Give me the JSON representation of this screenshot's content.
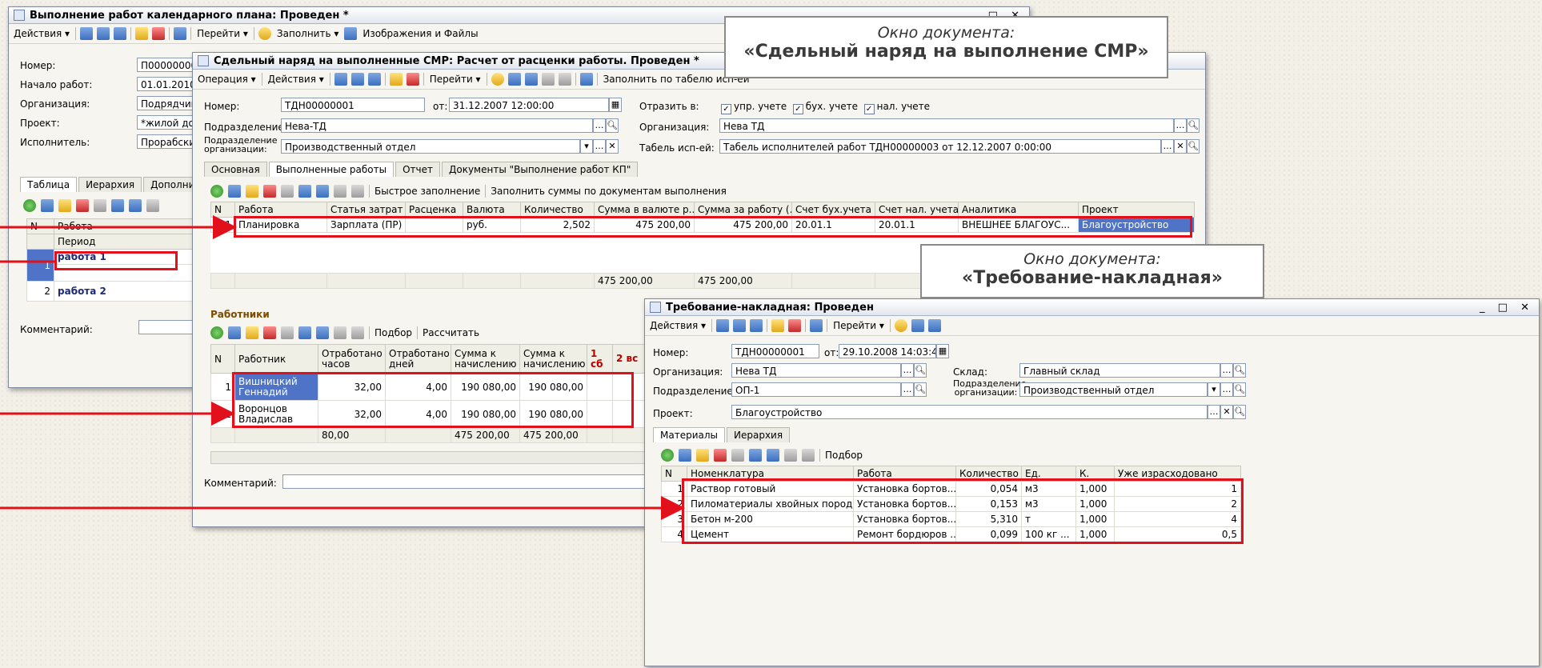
{
  "win1": {
    "title": "Выполнение работ календарного плана: Проведен *",
    "toolbar": [
      "Действия ▾",
      "Перейти ▾",
      "Заполнить ▾",
      "Изображения и Файлы"
    ],
    "fields": {
      "number_label": "Номер:",
      "number": "П00000000",
      "start_label": "Начало работ:",
      "start": "01.01.2010",
      "org_label": "Организация:",
      "org": "Подрядчик",
      "project_label": "Проект:",
      "project": "*жилой дом",
      "executor_label": "Исполнитель:",
      "executor": "Прорабски"
    },
    "tabs": [
      "Таблица",
      "Иерархия",
      "Дополнит"
    ],
    "table": {
      "headers": [
        "N",
        "Работа"
      ],
      "subheader": "Период",
      "rows": [
        {
          "n": "1",
          "work": "работа 1"
        },
        {
          "n": "2",
          "work": "работа 2"
        }
      ]
    },
    "comment_label": "Комментарий:"
  },
  "win2": {
    "title": "Сдельный наряд на выполненные СМР: Расчет от расценки работы. Проведен *",
    "toolbar": [
      "Операция ▾",
      "Действия ▾",
      "Перейти ▾",
      "Заполнить по табелю исп-ей"
    ],
    "fields": {
      "number_label": "Номер:",
      "number": "ТДН00000001",
      "from_label": "от:",
      "from": "31.12.2007 12:00:00",
      "reflect_label": "Отразить в:",
      "reflect": [
        "упр. учете",
        "бух. учете",
        "нал. учете"
      ],
      "dept_label": "Подразделение:",
      "dept": "Нева-ТД",
      "org_label": "Организация:",
      "org": "Нева ТД",
      "orgdept_label": "Подразделение организации:",
      "orgdept": "Производственный отдел",
      "timesheet_label": "Табель исп-ей:",
      "timesheet": "Табель исполнителей работ ТДН00000003 от 12.12.2007 0:00:00"
    },
    "tabs": [
      "Основная",
      "Выполненные работы",
      "Отчет",
      "Документы \"Выполнение работ КП\""
    ],
    "works_toolbar": [
      "Быстрое заполнение",
      "Заполнить суммы по документам выполнения"
    ],
    "works": {
      "headers": [
        "N",
        "Работа",
        "Статья затрат",
        "Расценка",
        "Валюта",
        "Количество",
        "Сумма в валюте р...",
        "Сумма за работу (...",
        "Счет бух.учета",
        "Счет нал. учета",
        "Аналитика",
        "Проект"
      ],
      "rows": [
        [
          "1",
          "Планировка",
          "Зарплата (ПР)",
          "",
          "руб.",
          "2,502",
          "475 200,00",
          "475 200,00",
          "20.01.1",
          "20.01.1",
          "ВНЕШНЕЕ БЛАГОУС...",
          "Благоустройство"
        ]
      ],
      "totals": [
        "475 200,00",
        "475 200,00"
      ]
    },
    "workers_title": "Работники",
    "workers_toolbar": [
      "Подбор",
      "Рассчитать"
    ],
    "workers": {
      "headers": [
        "N",
        "Работник",
        "Отработано часов",
        "Отработано дней",
        "Сумма к начислению",
        "Сумма к начислению",
        "1 сб",
        "2 вс"
      ],
      "rows": [
        [
          "1",
          "Вишницкий Геннадий",
          "32,00",
          "4,00",
          "190 080,00",
          "190 080,00"
        ],
        [
          "2",
          "Воронцов Владислав",
          "32,00",
          "4,00",
          "190 080,00",
          "190 080,00"
        ]
      ],
      "totals": [
        "80,00",
        "475 200,00",
        "475 200,00"
      ]
    },
    "comment_label": "Комментарий:"
  },
  "win3": {
    "title": "Требование-накладная: Проведен",
    "toolbar": [
      "Действия ▾",
      "Перейти ▾"
    ],
    "fields": {
      "number_label": "Номер:",
      "number": "ТДН00000001",
      "from_label": "от:",
      "from": "29.10.2008 14:03:45",
      "org_label": "Организация:",
      "org": "Нева ТД",
      "stock_label": "Склад:",
      "stock": "Главный склад",
      "dept_label": "Подразделение:",
      "dept": "ОП-1",
      "orgdept_label": "Подразделение организации:",
      "orgdept": "Производственный отдел",
      "project_label": "Проект:",
      "project": "Благоустройство"
    },
    "tabs": [
      "Материалы",
      "Иерархия"
    ],
    "sub_toolbar": "Подбор",
    "materials": {
      "headers": [
        "N",
        "Номенклатура",
        "Работа",
        "Количество",
        "Ед.",
        "К.",
        "Уже израсходовано"
      ],
      "rows": [
        [
          "1",
          "Раствор готовый",
          "Установка бортов...",
          "0,054",
          "м3",
          "1,000",
          "1"
        ],
        [
          "2",
          "Пиломатериалы хвойных пород",
          "Установка бортов...",
          "0,153",
          "м3",
          "1,000",
          "2"
        ],
        [
          "3",
          "Бетон м-200",
          "Установка бортов...",
          "5,310",
          "т",
          "1,000",
          "4"
        ],
        [
          "4",
          "Цемент",
          "Ремонт бордюров ...",
          "0,099",
          "100 кг ...",
          "1,000",
          "0,5"
        ]
      ]
    }
  },
  "callout1": {
    "line1": "Окно документа:",
    "line2": "«Сдельный наряд на выполнение СМР»"
  },
  "callout2": {
    "line1": "Окно документа:",
    "line2": "«Требование-накладная»"
  },
  "colors": {
    "highlight": "#e2101a",
    "selection": "#4e73c7"
  }
}
